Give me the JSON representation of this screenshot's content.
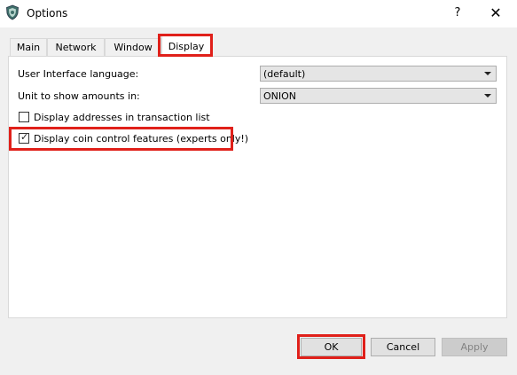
{
  "window": {
    "title": "Options",
    "help_label": "?",
    "close_label": "✕",
    "icon": "shield-app-icon"
  },
  "tabs": [
    {
      "label": "Main",
      "active": false
    },
    {
      "label": "Network",
      "active": false
    },
    {
      "label": "Window",
      "active": false
    },
    {
      "label": "Display",
      "active": true
    }
  ],
  "display": {
    "language_label": "User Interface language:",
    "language_value": "(default)",
    "unit_label": "Unit to show amounts in:",
    "unit_value": "ONION",
    "display_addresses": {
      "label": "Display addresses in transaction list",
      "checked": false
    },
    "coin_control": {
      "label": "Display coin control features (experts only!)",
      "checked": true
    }
  },
  "buttons": {
    "ok": "OK",
    "cancel": "Cancel",
    "apply": "Apply"
  },
  "colors": {
    "highlight": "#e0201a",
    "panel_bg": "#ffffff",
    "window_bg": "#f0f0f0"
  }
}
